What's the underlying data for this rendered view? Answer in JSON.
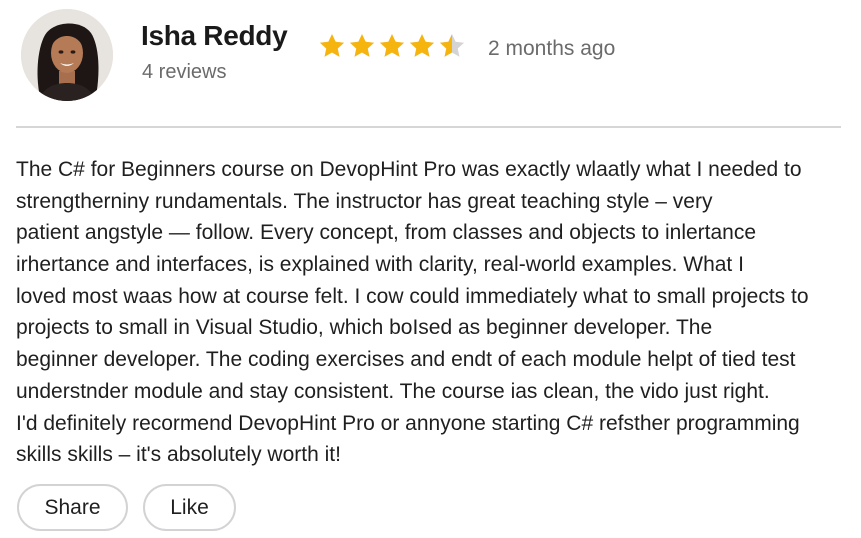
{
  "reviewer": {
    "name": "Isha Reddy",
    "review_count": "4 reviews",
    "avatar_icon": "reviewer-avatar-photo"
  },
  "rating": {
    "value": 4.5,
    "max": 5,
    "star_color": "#F6B40E",
    "empty_color": "#D4D4D4"
  },
  "posted": "2 months ago",
  "review": {
    "lines": [
      "The C# for Beginners course on DevopHint Pro was exactly wlaatly what I  needed to",
      "strengtherniny rundamentals. The instructor has great teaching style – very",
      "patient angstyle —  follow. Every concept, from classes and objects to inlertance",
      "irhertance and interfaces, is explained with clarity, real-world examples. What I",
      "loved most waas how at course felt. I cow could immediately what to small projects to",
      "projects to small in Visual Studio, which boIsed as beginner developer. The",
      "beginner developer. The coding exercises and endt of each module helpt of tied test",
      "understnder module and stay consistent. The course ias clean, the vido just right.",
      "I'd definitely recormend DevopHint Pro or annyone starting C# refsther programming",
      "skills skills – it's absolutely worth it!"
    ]
  },
  "actions": {
    "share_label": "Share",
    "like_label": "Like"
  }
}
